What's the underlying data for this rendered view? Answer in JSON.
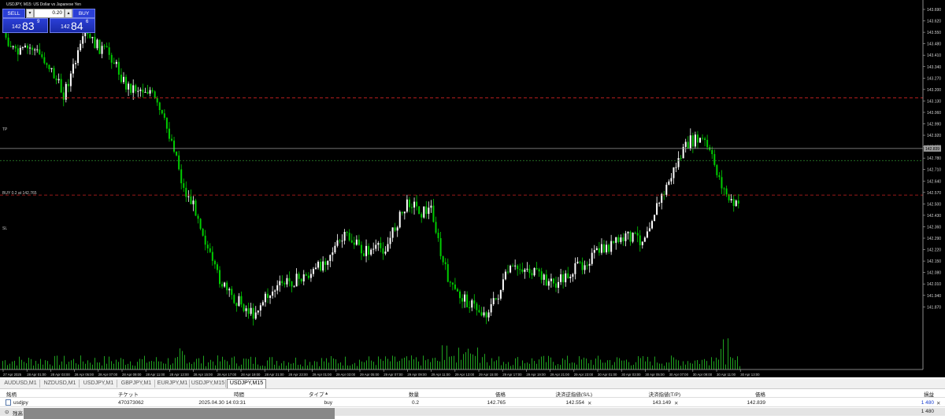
{
  "chart": {
    "title": "USDJPY, M15: US Dollar vs Japanese Yen",
    "tp_label": "TP",
    "sl_label": "SL",
    "buy_label": "BUY 0.2 at 142.765",
    "current_price_label": "142.839",
    "price_axis": [
      "143.690",
      "143.620",
      "143.550",
      "143.480",
      "143.410",
      "143.340",
      "143.270",
      "143.200",
      "143.130",
      "143.060",
      "142.990",
      "142.920",
      "142.850",
      "142.780",
      "142.710",
      "142.640",
      "142.570",
      "142.500",
      "142.430",
      "142.360",
      "142.290",
      "142.220",
      "142.150",
      "142.080",
      "142.010",
      "141.940",
      "141.870"
    ],
    "time_axis": [
      "27 Apr 2025",
      "28 Apr 01:00",
      "28 Apr 03:00",
      "28 Apr 05:00",
      "28 Apr 07:00",
      "28 Apr 09:00",
      "28 Apr 11:00",
      "28 Apr 13:00",
      "28 Apr 15:00",
      "28 Apr 17:00",
      "28 Apr 19:00",
      "28 Apr 21:00",
      "28 Apr 23:00",
      "29 Apr 01:00",
      "29 Apr 03:00",
      "29 Apr 05:00",
      "29 Apr 07:00",
      "29 Apr 09:00",
      "29 Apr 11:00",
      "29 Apr 13:00",
      "29 Apr 15:00",
      "29 Apr 17:00",
      "29 Apr 19:00",
      "29 Apr 21:00",
      "29 Apr 23:00",
      "30 Apr 01:00",
      "30 Apr 03:00",
      "30 Apr 05:00",
      "30 Apr 07:00",
      "30 Apr 09:00",
      "30 Apr 11:00",
      "30 Apr 13:00"
    ],
    "levels": {
      "tp": 143.149,
      "sl": 142.554,
      "entry": 142.765,
      "current": 142.839
    }
  },
  "oneclick": {
    "sell_label": "SELL",
    "buy_label": "BUY",
    "lot": "0.20",
    "bid_small": "142",
    "bid_big": "83",
    "bid_sup": "9",
    "ask_small": "142",
    "ask_big": "84",
    "ask_sup": "6"
  },
  "tabs": [
    "AUDUSD,M1",
    "NZDUSD,M1",
    "USDJPY,M1",
    "GBPJPY,M1",
    "EURJPY,M1",
    "USDJPY,M15",
    "USDJPY,M15"
  ],
  "table": {
    "headers": {
      "symbol": "銘柄",
      "ticket": "チケット",
      "time": "時間",
      "type": "タイプ",
      "volume": "数量",
      "price": "価格",
      "sl": "決済逆指値(S/L)",
      "tp": "決済指値(T/P)",
      "cur_price": "価格",
      "profit": "損益"
    },
    "row": {
      "symbol": "usdjpy",
      "ticket": "470373062",
      "time": "2025.04.30 14:03:31",
      "type": "buy",
      "volume": "0.2",
      "price": "142.765",
      "sl": "142.554",
      "tp": "143.149",
      "cur_price": "142.839",
      "profit": "1 480"
    },
    "balance_label": "残高",
    "balance_profit": "1 480"
  },
  "colors": {
    "bull": "#ffffff",
    "bear": "#00cc00",
    "tp_line": "#cc2222",
    "sl_line": "#cc2222",
    "buy_line": "#2f8f2f",
    "bid_line": "#9a9a9a",
    "button": "#2b3fd6"
  }
}
